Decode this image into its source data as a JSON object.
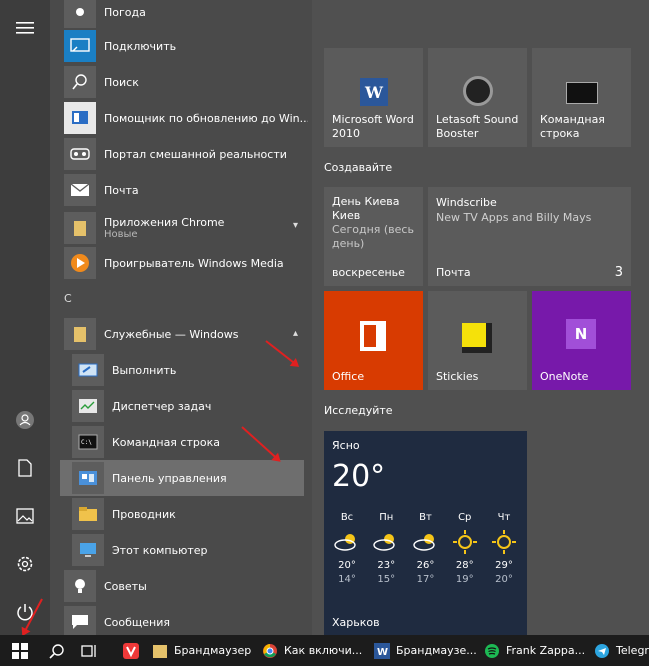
{
  "apps": {
    "pogoda": "Погода",
    "connect": "Подключить",
    "search": "Поиск",
    "helper": "Помощник по обновлению до Win...",
    "mixed": "Портал смешанной реальности",
    "mail": "Почта",
    "chrome_apps": "Приложения Chrome",
    "chrome_apps_sub": "Новые",
    "wmp": "Проигрыватель Windows Media",
    "letter_c": "С",
    "system_folder": "Служебные — Windows",
    "run": "Выполнить",
    "taskmgr": "Диспетчер задач",
    "cmd": "Командная строка",
    "control_panel": "Панель управления",
    "explorer": "Проводник",
    "this_pc": "Этот компьютер",
    "tips": "Советы",
    "messages": "Сообщения"
  },
  "tiles": {
    "word": "Microsoft Word 2010",
    "word_l1": "Microsoft Word",
    "word_l2": "2010",
    "sound_l1": "Letasoft Sound",
    "sound_l2": "Booster",
    "cmd_l1": "Командная",
    "cmd_l2": "строка",
    "group_create": "Создавайте",
    "calendar_l1": "День Киева",
    "calendar_l2": "Киев",
    "calendar_l3": "Сегодня (весь",
    "calendar_l4": "день)",
    "calendar_day": "воскресенье",
    "mail_title": "Windscribe",
    "mail_l2": "New TV Apps and Billy Mays",
    "mail_label": "Почта",
    "mail_count": "3",
    "office": "Office",
    "stickies": "Stickies",
    "onenote": "OneNote",
    "group_explore": "Исследуйте",
    "weather_cond": "Ясно",
    "weather_temp": "20°",
    "weather_city": "Харьков",
    "forecast": [
      {
        "day": "Вс",
        "hi": "20°",
        "lo": "14°"
      },
      {
        "day": "Пн",
        "hi": "23°",
        "lo": "15°"
      },
      {
        "day": "Вт",
        "hi": "26°",
        "lo": "17°"
      },
      {
        "day": "Ср",
        "hi": "28°",
        "lo": "19°"
      },
      {
        "day": "Чт",
        "hi": "29°",
        "lo": "20°"
      }
    ]
  },
  "taskbar": {
    "t1": "Брандмаузер",
    "t2": "Как включи...",
    "t3": "Брандмаузе...",
    "t4": "Frank Zappa...",
    "t5": "Telegr"
  }
}
